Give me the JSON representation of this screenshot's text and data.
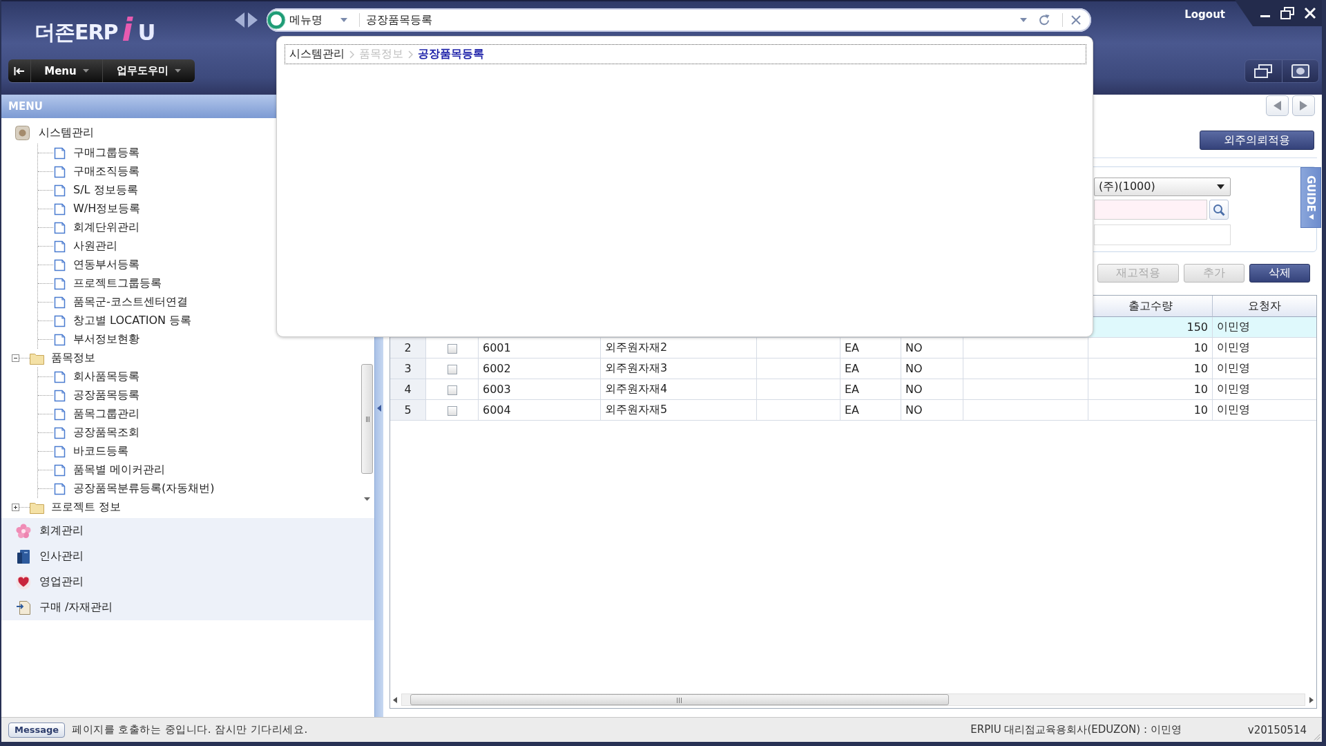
{
  "header": {
    "logo": {
      "prefix": "더존ERP",
      "mark": "i",
      "suffix": "U"
    },
    "toolbar": [
      {
        "label": "Menu"
      },
      {
        "label": "업무도우미"
      }
    ],
    "logout": "Logout"
  },
  "menu_search": {
    "scope": "메뉴명",
    "value": "공장품목등록"
  },
  "popup": {
    "breadcrumb": [
      {
        "label": "시스템관리",
        "kind": "link"
      },
      {
        "label": "품목정보",
        "kind": "muted"
      },
      {
        "label": "공장품목등록",
        "kind": "current"
      }
    ]
  },
  "sidebar": {
    "title": "MENU",
    "tree": [
      {
        "label": "시스템관리",
        "kind": "module",
        "children": [
          {
            "label": "구매그룹등록"
          },
          {
            "label": "구매조직등록"
          },
          {
            "label": "S/L 정보등록"
          },
          {
            "label": "W/H정보등록"
          },
          {
            "label": "회계단위관리"
          },
          {
            "label": "사원관리"
          },
          {
            "label": "연동부서등록"
          },
          {
            "label": "프로젝트그룹등록"
          },
          {
            "label": "품목군-코스트센터연결"
          },
          {
            "label": "창고별 LOCATION 등록"
          },
          {
            "label": "부서정보현황"
          }
        ]
      },
      {
        "label": "품목정보",
        "kind": "folder",
        "expanded": true,
        "children": [
          {
            "label": "회사품목등록"
          },
          {
            "label": "공장품목등록"
          },
          {
            "label": "품목그룹관리"
          },
          {
            "label": "공장품목조회"
          },
          {
            "label": "바코드등록"
          },
          {
            "label": "품목별 메이커관리"
          },
          {
            "label": "공장품목분류등록(자동채번)"
          }
        ]
      },
      {
        "label": "프로젝트 정보",
        "kind": "folder",
        "expanded": false
      }
    ],
    "modules": [
      {
        "label": "회계관리"
      },
      {
        "label": "인사관리"
      },
      {
        "label": "영업관리"
      },
      {
        "label": "구매 /자재관리"
      }
    ]
  },
  "main": {
    "apply_button": "외주의뢰적용",
    "filters": [
      {
        "kind": "combo",
        "value": "(주)(1000)",
        "required": false
      },
      {
        "kind": "search",
        "required": true
      },
      {
        "kind": "text",
        "required": false
      }
    ],
    "guide_tab": "GUIDE",
    "actions": [
      {
        "label": "재고적용",
        "disabled": true
      },
      {
        "label": "추가",
        "disabled": true
      },
      {
        "label": "삭제",
        "disabled": false
      }
    ],
    "table": {
      "columns": [
        {
          "label": "출고수량"
        },
        {
          "label": "요청자"
        }
      ],
      "rows": [
        {
          "selected": true,
          "issue_qty": "150",
          "requester": "이민영"
        },
        {
          "selected": false,
          "row_number": "2",
          "checked": false,
          "column_3": "6001",
          "column_4": "외주원자재2",
          "column_6": "EA",
          "column_7": "NO",
          "issue_qty": "10",
          "requester": "이민영"
        },
        {
          "selected": false,
          "row_number": "3",
          "checked": false,
          "column_3": "6002",
          "column_4": "외주원자재3",
          "column_6": "EA",
          "column_7": "NO",
          "issue_qty": "10",
          "requester": "이민영"
        },
        {
          "selected": false,
          "row_number": "4",
          "checked": false,
          "column_3": "6003",
          "column_4": "외주원자재4",
          "column_6": "EA",
          "column_7": "NO",
          "issue_qty": "10",
          "requester": "이민영"
        },
        {
          "selected": false,
          "row_number": "5",
          "checked": false,
          "column_3": "6004",
          "column_4": "외주원자재5",
          "column_6": "EA",
          "column_7": "NO",
          "issue_qty": "10",
          "requester": "이민영"
        }
      ]
    }
  },
  "status_bar": {
    "message_label": "Message",
    "message": "페이지를 호출하는 중입니다. 잠시만 기다리세요.",
    "user_info": "ERPIU 대리점교육용회사(EDUZON) : 이민영",
    "version": "v20150514"
  }
}
